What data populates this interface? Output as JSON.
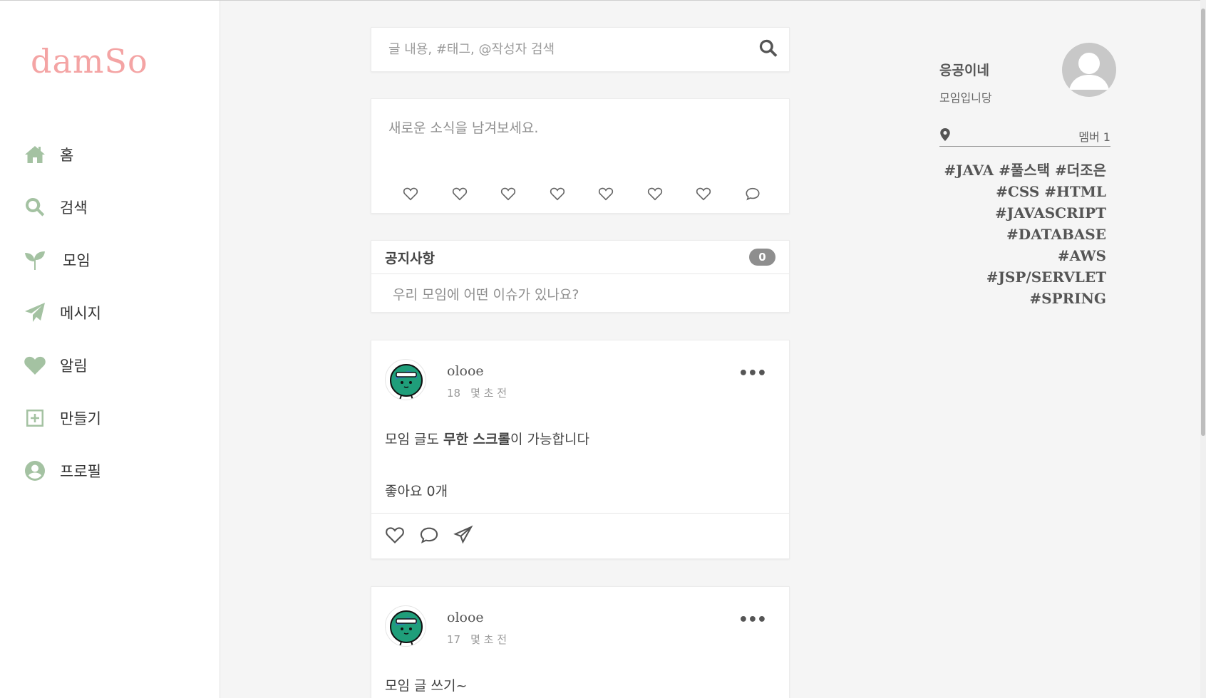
{
  "app": {
    "logo": "damSo"
  },
  "sidebar": {
    "items": [
      {
        "label": "홈",
        "icon": "home-icon"
      },
      {
        "label": "검색",
        "icon": "search-icon"
      },
      {
        "label": "모임",
        "icon": "sprout-icon"
      },
      {
        "label": "메시지",
        "icon": "paper-plane-icon"
      },
      {
        "label": "알림",
        "icon": "heart-icon"
      },
      {
        "label": "만들기",
        "icon": "plus-square-icon"
      },
      {
        "label": "프로필",
        "icon": "user-circle-icon"
      }
    ]
  },
  "search": {
    "placeholder": "글 내용, #태그, @작성자 검색"
  },
  "compose": {
    "placeholder": "새로운 소식을 남겨보세요."
  },
  "notice": {
    "title": "공지사항",
    "count": "0",
    "placeholder": "우리 모임에 어떤 이슈가 있나요?"
  },
  "posts": [
    {
      "author": "olooe",
      "number": "18",
      "time": "몇 초 전",
      "body_before": "모임 글도 ",
      "body_bold": "무한 스크롤",
      "body_after": "이 가능합니다",
      "likes": "좋아요 0개"
    },
    {
      "author": "olooe",
      "number": "17",
      "time": "몇 초 전",
      "body": "모임 글 쓰기~"
    }
  ],
  "group": {
    "name": "응공이네",
    "description": "모임입니당",
    "members": "멤버 1",
    "tags": [
      "#JAVA #풀스택 #더조은",
      "#CSS #HTML",
      "#JAVASCRIPT",
      "#DATABASE",
      "#AWS #JSP/SERVLET",
      "#SPRING"
    ]
  },
  "colors": {
    "logo": "#f4a4a4",
    "nav_icon": "#a4c2a2",
    "badge": "#8e8e8e"
  }
}
